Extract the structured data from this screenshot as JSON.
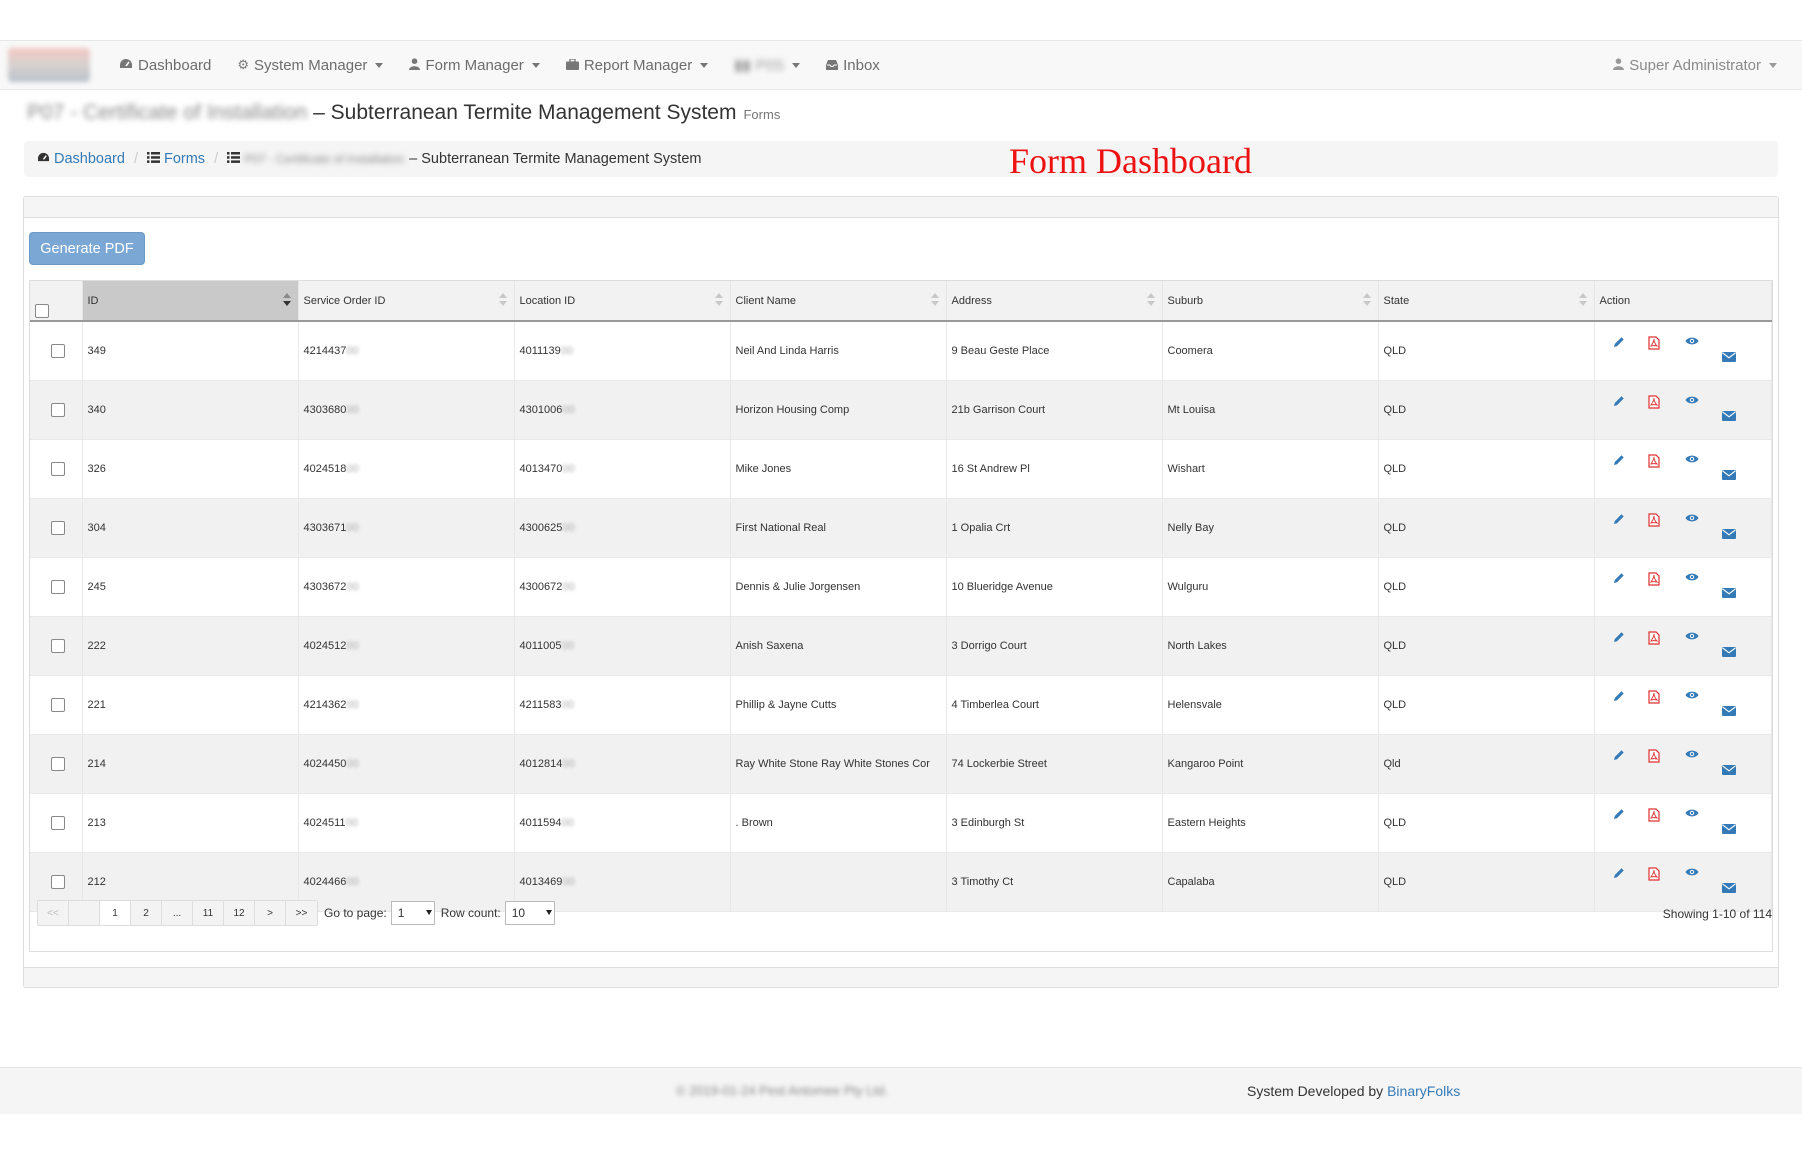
{
  "nav": {
    "items": [
      {
        "label": "Dashboard",
        "icon": "dashboard-icon"
      },
      {
        "label": "System Manager",
        "icon": "gear-icon"
      },
      {
        "label": "Form Manager",
        "icon": "user-icon"
      },
      {
        "label": "Report Manager",
        "icon": "briefcase-icon"
      },
      {
        "label": "P0S",
        "icon": "blurred-icon"
      },
      {
        "label": "Inbox",
        "icon": "inbox-icon"
      }
    ],
    "user": "Super Administrator"
  },
  "page": {
    "title_blurred": "P07 - Certificate of Installation",
    "title_main": "– Subterranean Termite Management System",
    "title_small": "Forms"
  },
  "breadcrumb": {
    "dashboard": "Dashboard",
    "forms": "Forms",
    "current_blurred": "P07 - Certificate of Installation",
    "current_main": "– Subterranean Termite Management System"
  },
  "annotation": "Form Dashboard",
  "toolbar": {
    "generate_pdf": "Generate PDF"
  },
  "table": {
    "columns": [
      "ID",
      "Service Order ID",
      "Location ID",
      "Client Name",
      "Address",
      "Suburb",
      "State",
      "Action"
    ],
    "rows": [
      {
        "id": "349",
        "so": "4214437",
        "so_mask": "00",
        "loc": "4011139",
        "loc_mask": "00",
        "client": "Neil And Linda Harris",
        "address": "9 Beau Geste Place",
        "suburb": "Coomera",
        "state": "QLD"
      },
      {
        "id": "340",
        "so": "4303680",
        "so_mask": "00",
        "loc": "4301006",
        "loc_mask": "00",
        "client": "Horizon Housing Comp",
        "address": "21b Garrison Court",
        "suburb": "Mt Louisa",
        "state": "QLD"
      },
      {
        "id": "326",
        "so": "4024518",
        "so_mask": "00",
        "loc": "4013470",
        "loc_mask": "00",
        "client": "Mike Jones",
        "address": "16 St Andrew Pl",
        "suburb": "Wishart",
        "state": "QLD"
      },
      {
        "id": "304",
        "so": "4303671",
        "so_mask": "00",
        "loc": "4300625",
        "loc_mask": "00",
        "client": "First National Real",
        "address": "1 Opalia Crt",
        "suburb": "Nelly Bay",
        "state": "QLD"
      },
      {
        "id": "245",
        "so": "4303672",
        "so_mask": "00",
        "loc": "4300672",
        "loc_mask": "00",
        "client": "Dennis & Julie Jorgensen",
        "address": "10 Blueridge Avenue",
        "suburb": "Wulguru",
        "state": "QLD"
      },
      {
        "id": "222",
        "so": "4024512",
        "so_mask": "00",
        "loc": "4011005",
        "loc_mask": "00",
        "client": "Anish Saxena",
        "address": "3 Dorrigo Court",
        "suburb": "North Lakes",
        "state": "QLD"
      },
      {
        "id": "221",
        "so": "4214362",
        "so_mask": "00",
        "loc": "4211583",
        "loc_mask": "00",
        "client": "Phillip & Jayne Cutts",
        "address": "4 Timberlea Court",
        "suburb": "Helensvale",
        "state": "QLD"
      },
      {
        "id": "214",
        "so": "4024450",
        "so_mask": "00",
        "loc": "4012814",
        "loc_mask": "00",
        "client": "Ray White Stone Ray White Stones Cor",
        "address": "74 Lockerbie Street",
        "suburb": "Kangaroo Point",
        "state": "Qld"
      },
      {
        "id": "213",
        "so": "4024511",
        "so_mask": "00",
        "loc": "4011594",
        "loc_mask": "00",
        "client": ". Brown",
        "address": "3 Edinburgh St",
        "suburb": "Eastern Heights",
        "state": "QLD"
      },
      {
        "id": "212",
        "so": "4024466",
        "so_mask": "00",
        "loc": "4013469",
        "loc_mask": "00",
        "client": "",
        "address": "3 Timothy Ct",
        "suburb": "Capalaba",
        "state": "QLD"
      }
    ]
  },
  "pager": {
    "buttons": [
      "<<",
      "",
      "1",
      "2",
      "...",
      "11",
      "12",
      ">",
      ">>"
    ],
    "goto_label": "Go to page:",
    "goto_value": "1",
    "rowcount_label": "Row count:",
    "rowcount_value": "10",
    "showing": "Showing 1-10 of 114"
  },
  "footer": {
    "copyright": "© 2019-01-24 Pest Antomee Pty Ltd.",
    "developed_prefix": "System Developed by",
    "developed_link": "BinaryFolks"
  },
  "colors": {
    "link": "#337ab7",
    "pdf_icon": "#e0312f",
    "annotation": "#ee1111",
    "button": "#7aa7d3"
  }
}
